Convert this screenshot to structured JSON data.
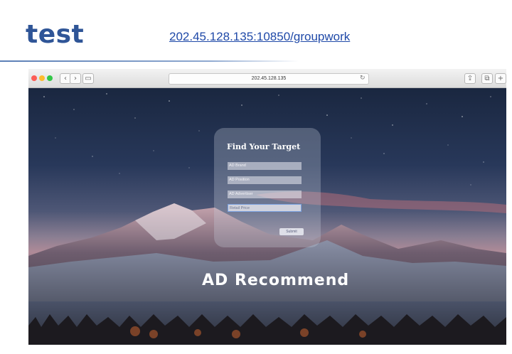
{
  "slide": {
    "title": "test",
    "link": "202.45.128.135:10850/groupwork"
  },
  "browser": {
    "address": "202.45.128.135",
    "back_glyph": "‹",
    "forward_glyph": "›",
    "sidebar_glyph": "▭",
    "reload_glyph": "↻",
    "share_glyph": "⇪",
    "tabs_glyph": "⧉",
    "new_tab_glyph": "+"
  },
  "form": {
    "title": "Find Your Target",
    "fields": [
      {
        "placeholder": "AD Brand"
      },
      {
        "placeholder": "AD Position"
      },
      {
        "placeholder": "AD Advertiser"
      },
      {
        "placeholder": "Retail Price"
      }
    ],
    "submit_label": "Submit"
  },
  "brand_text": "AD Recommend",
  "colors": {
    "slide_title": "#2f5597",
    "link": "#1f49a8",
    "glass_panel": "#c8cddc"
  }
}
